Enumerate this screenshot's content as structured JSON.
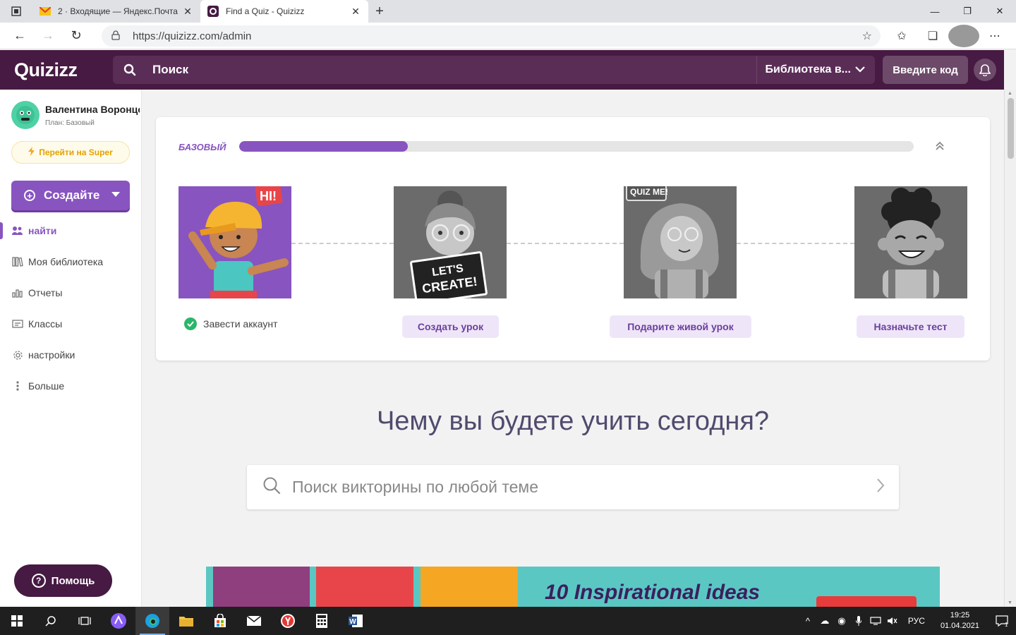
{
  "browser": {
    "tabs": [
      {
        "title": "2 · Входящие — Яндекс.Почта",
        "active": false
      },
      {
        "title": "Find a Quiz - Quizizz",
        "active": true
      }
    ],
    "url": "https://quizizz.com/admin"
  },
  "header": {
    "logo": "Quizizz",
    "search_label": "Поиск",
    "library_label": "Библиотека в...",
    "enter_code_label": "Введите код"
  },
  "sidebar": {
    "user_name": "Валентина Воронцова",
    "user_plan": "План: Базовый",
    "super_label": "Перейти на Super",
    "create_label": "Создайте",
    "nav": [
      {
        "label": "найти",
        "icon": "find-icon",
        "active": true
      },
      {
        "label": "Моя библиотека",
        "icon": "library-icon",
        "active": false
      },
      {
        "label": "Отчеты",
        "icon": "reports-icon",
        "active": false
      },
      {
        "label": "Классы",
        "icon": "classes-icon",
        "active": false
      },
      {
        "label": "настройки",
        "icon": "settings-icon",
        "active": false
      },
      {
        "label": "Больше",
        "icon": "more-icon",
        "active": false
      }
    ],
    "help_label": "Помощь"
  },
  "onboarding": {
    "plan_label": "БАЗОВЫЙ",
    "progress": 0.25,
    "steps": [
      {
        "label": "Завести аккаунт",
        "done": true,
        "badge": "HI!"
      },
      {
        "label": "Создать урок",
        "done": false,
        "badge": "LET'S CREATE!"
      },
      {
        "label": "Подарите живой урок",
        "done": false,
        "badge": "QUIZ ME!"
      },
      {
        "label": "Назначьте тест",
        "done": false,
        "badge": ""
      }
    ]
  },
  "main": {
    "heading": "Чему вы будете учить сегодня?",
    "search_placeholder": "Поиск викторины по любой теме",
    "banner_text": "10 Inspirational ideas"
  },
  "taskbar": {
    "language": "РУС",
    "time": "19:25",
    "date": "01.04.2021",
    "notifications": "1"
  },
  "colors": {
    "brand_dark": "#461a42",
    "brand_purple": "#8854c0",
    "success": "#2ab76b"
  }
}
